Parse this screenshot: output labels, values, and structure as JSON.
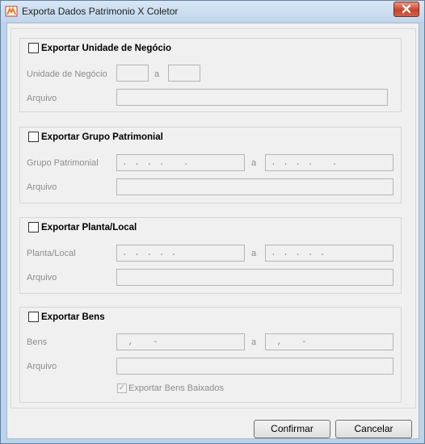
{
  "window": {
    "title": "Exporta Dados Patrimonio X Coletor"
  },
  "unidade": {
    "checkbox_label": "Exportar Unidade de Negócio",
    "range_label": "Unidade de Negócio",
    "separator": "a",
    "from_value": "",
    "to_value": "",
    "arquivo_label": "Arquivo",
    "arquivo_value": ""
  },
  "grupo": {
    "checkbox_label": "Exportar Grupo Patrimonial",
    "range_label": "Grupo Patrimonial",
    "separator": "a",
    "from_value": ". . . .   .",
    "to_value": ". . . .   .",
    "arquivo_label": "Arquivo",
    "arquivo_value": ""
  },
  "planta": {
    "checkbox_label": "Exportar Planta/Local",
    "range_label": "Planta/Local",
    "separator": "a",
    "from_value": ". . . . .",
    "to_value": ". . . . .",
    "arquivo_label": "Arquivo",
    "arquivo_value": ""
  },
  "bens": {
    "checkbox_label": "Exportar Bens",
    "range_label": "Bens",
    "separator": "a",
    "from_value": " ,   -",
    "to_value": " ,   -",
    "arquivo_label": "Arquivo",
    "arquivo_value": "",
    "baixados_label": "Exportar Bens Baixados",
    "baixados_checked": true
  },
  "buttons": {
    "confirmar": "Confirmar",
    "cancelar": "Cancelar"
  }
}
